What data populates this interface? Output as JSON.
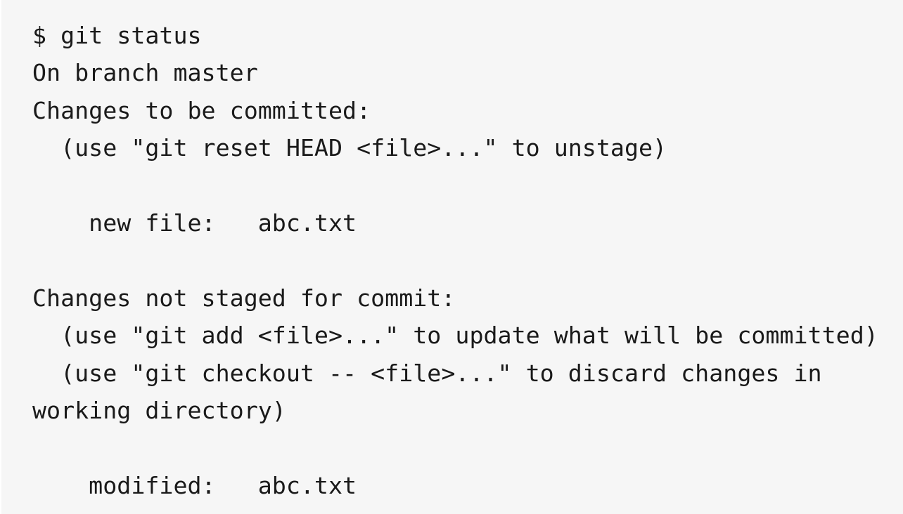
{
  "terminal": {
    "lines": [
      "$ git status",
      "On branch master",
      "Changes to be committed:",
      "  (use \"git reset HEAD <file>...\" to unstage)",
      "",
      "    new file:   abc.txt",
      "",
      "Changes not staged for commit:",
      "  (use \"git add <file>...\" to update what will be committed)",
      "  (use \"git checkout -- <file>...\" to discard changes in",
      "working directory)",
      "",
      "    modified:   abc.txt"
    ]
  }
}
